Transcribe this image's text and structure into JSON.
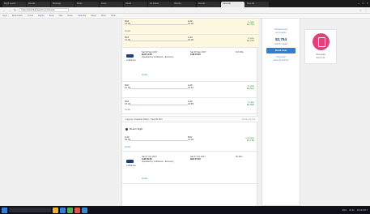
{
  "browser": {
    "tabs": [
      "Flight search",
      "Results",
      "Bookings",
      "Deals",
      "Fares",
      "Hotels",
      "Air tickets",
      "Itinerary",
      "Results",
      "Calendar",
      "New tab"
    ],
    "active_tab_index": 9,
    "url": "https://www.flightsearch.com/results",
    "bookmarks": [
      "Apps",
      "Bookmarks",
      "Travel",
      "Flights",
      "Bank",
      "Mail",
      "News",
      "Calendar",
      "Maps",
      "Work",
      "Other"
    ]
  },
  "results": {
    "cards": [
      {
        "dep": "BLR",
        "dep_time": "14:00",
        "arr": "LHR",
        "arr_time": "19:30",
        "price": "$2,754",
        "note": "1 stop",
        "link": "Details",
        "highlight": true
      },
      {
        "dep": "BLR",
        "dep_time": "14:00",
        "arr": "LHR",
        "arr_time": "19:30",
        "price": "$2,754",
        "note": "1 stop",
        "link": "Details",
        "highlight": false
      },
      {
        "dep": "BLR",
        "dep_time": "16:45",
        "arr": "LHR",
        "arr_time": "22:10",
        "price": "$2,812",
        "note": "1 stop",
        "link": "Details",
        "highlight": false
      },
      {
        "dep": "BLR",
        "dep_time": "18:20",
        "arr": "LHR",
        "arr_time": "23:55",
        "price": "$2,905",
        "note": "1 stop",
        "link": "Details",
        "highlight": false
      }
    ],
    "segment_top": {
      "airline": "Lufthansa",
      "depart_date": "Sat 30 Sep 2017",
      "depart": "BLR 14:00",
      "arrive_date": "Sat 30 Sep 2017",
      "arrive": "LHR 19:30",
      "duration": "10h 30m",
      "extra": "Operated by Lufthansa · Economy"
    },
    "banner": {
      "text": "Layover: Frankfurt (FRA) · Total 2h 15m",
      "right": "Arrives 01 Oct"
    },
    "section_head": "Return flight",
    "bottom_card": {
      "dep": "LHR",
      "dep_time": "09:00",
      "arr": "BLR",
      "arr_time": "21:30",
      "price": "$1,150",
      "note": "nonstop",
      "link": "Details"
    },
    "segment_bottom": {
      "airline": "Lufthansa",
      "depart_date": "Sat 07 Oct 2017",
      "depart": "LHR 09:00",
      "arrive_date": "Sat 07 Oct 2017",
      "arrive": "BLR 21:30",
      "duration": "9h 00m",
      "extra": "Operated by Lufthansa · Economy"
    }
  },
  "sidebar": {
    "top_label": "Cheapest fare",
    "sub_label": "per traveller",
    "price": "$2,754",
    "price_note": "total for 1 adult",
    "book_button": "Book now",
    "link": "View deal",
    "link2": "Show all options"
  },
  "ad": {
    "title": "Hotel deals",
    "sub": "Book now"
  },
  "taskbar": {
    "time": "10:42",
    "date": "29-09-2017",
    "lang": "ENG"
  },
  "colors": {
    "accent": "#2f7fd4",
    "brand": "#1d3f7a",
    "price_green": "#2a9b3d",
    "ad_pink": "#e3407a"
  }
}
